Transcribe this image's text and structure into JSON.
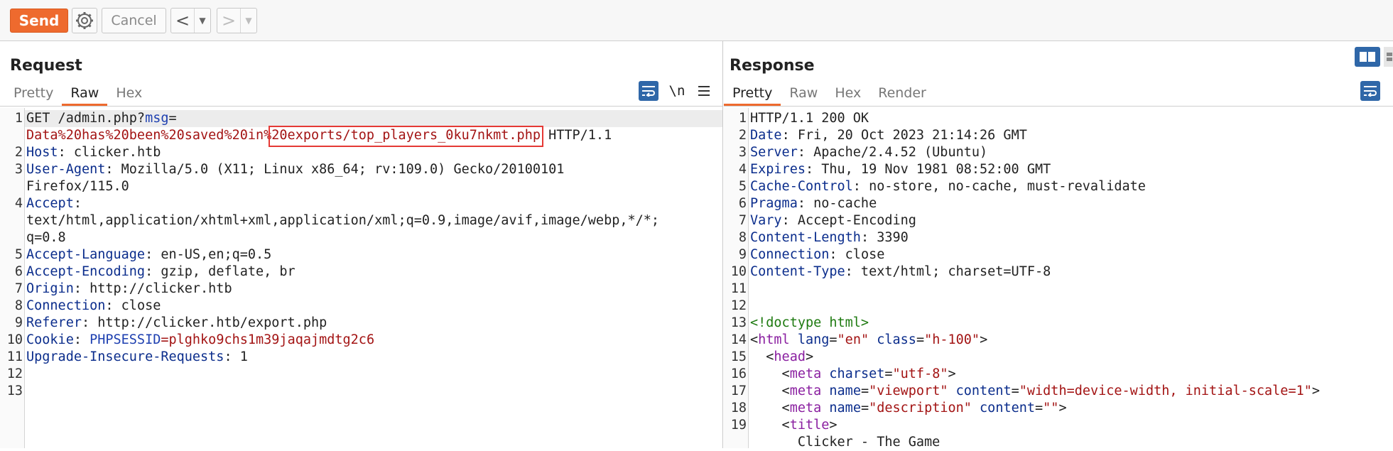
{
  "toolbar": {
    "send_label": "Send",
    "cancel_label": "Cancel"
  },
  "request": {
    "title": "Request",
    "tabs": [
      "Pretty",
      "Raw",
      "Hex"
    ],
    "active_tab": "Raw",
    "newline_toggle": "\\n",
    "lines": [
      {
        "n": "1",
        "key": "GET /admin.php?",
        "param": "msg",
        "rest": "="
      },
      {
        "n": "",
        "red": "Data%20has%20been%20saved%20in%20exports/top_players_0ku7nkmt.php",
        "tail": " HTTP/1.1"
      },
      {
        "n": "2",
        "key": "Host",
        "val": ": clicker.htb"
      },
      {
        "n": "3",
        "key": "User-Agent",
        "val": ": Mozilla/5.0 (X11; Linux x86_64; rv:109.0) Gecko/20100101"
      },
      {
        "n": "",
        "val": "Firefox/115.0"
      },
      {
        "n": "4",
        "key": "Accept",
        "val": ":"
      },
      {
        "n": "",
        "val": "text/html,application/xhtml+xml,application/xml;q=0.9,image/avif,image/webp,*/*;"
      },
      {
        "n": "",
        "val": "q=0.8"
      },
      {
        "n": "5",
        "key": "Accept-Language",
        "val": ": en-US,en;q=0.5"
      },
      {
        "n": "6",
        "key": "Accept-Encoding",
        "val": ": gzip, deflate, br"
      },
      {
        "n": "7",
        "key": "Origin",
        "val": ": http://clicker.htb"
      },
      {
        "n": "8",
        "key": "Connection",
        "val": ": close"
      },
      {
        "n": "9",
        "key": "Referer",
        "val": ": http://clicker.htb/export.php"
      },
      {
        "n": "10",
        "key": "Cookie",
        "val": ": ",
        "param": "PHPSESSID",
        "red": "=plghko9chs1m39jaqajmdtg2c6"
      },
      {
        "n": "11",
        "key": "Upgrade-Insecure-Requests",
        "val": ": 1"
      },
      {
        "n": "12"
      },
      {
        "n": "13"
      }
    ]
  },
  "response": {
    "title": "Response",
    "tabs": [
      "Pretty",
      "Raw",
      "Hex",
      "Render"
    ],
    "active_tab": "Pretty",
    "lines": [
      {
        "n": "1",
        "key": "HTTP/1.1 200 OK"
      },
      {
        "n": "2",
        "key": "Date",
        "val": ": Fri, 20 Oct 2023 21:14:26 GMT"
      },
      {
        "n": "3",
        "key": "Server",
        "val": ": Apache/2.4.52 (Ubuntu)"
      },
      {
        "n": "4",
        "key": "Expires",
        "val": ": Thu, 19 Nov 1981 08:52:00 GMT"
      },
      {
        "n": "5",
        "key": "Cache-Control",
        "val": ": no-store, no-cache, must-revalidate"
      },
      {
        "n": "6",
        "key": "Pragma",
        "val": ": no-cache"
      },
      {
        "n": "7",
        "key": "Vary",
        "val": ": Accept-Encoding"
      },
      {
        "n": "8",
        "key": "Content-Length",
        "val": ": 3390"
      },
      {
        "n": "9",
        "key": "Connection",
        "val": ": close"
      },
      {
        "n": "10",
        "key": "Content-Type",
        "val": ": text/html; charset=UTF-8"
      },
      {
        "n": "11"
      },
      {
        "n": "12"
      },
      {
        "n": "13",
        "doctype": "<!doctype html>"
      },
      {
        "n": "14",
        "html": [
          [
            "p",
            "<"
          ],
          [
            "t",
            "html"
          ],
          [
            "p",
            " "
          ],
          [
            "a",
            "lang"
          ],
          [
            "p",
            "="
          ],
          [
            "s",
            "\"en\""
          ],
          [
            "p",
            " "
          ],
          [
            "a",
            "class"
          ],
          [
            "p",
            "="
          ],
          [
            "s",
            "\"h-100\""
          ],
          [
            "p",
            ">"
          ]
        ]
      },
      {
        "n": "15",
        "html": [
          [
            "p",
            "  <"
          ],
          [
            "t",
            "head"
          ],
          [
            "p",
            ">"
          ]
        ]
      },
      {
        "n": "16",
        "html": [
          [
            "p",
            "    <"
          ],
          [
            "t",
            "meta"
          ],
          [
            "p",
            " "
          ],
          [
            "a",
            "charset"
          ],
          [
            "p",
            "="
          ],
          [
            "s",
            "\"utf-8\""
          ],
          [
            "p",
            ">"
          ]
        ]
      },
      {
        "n": "17",
        "html": [
          [
            "p",
            "    <"
          ],
          [
            "t",
            "meta"
          ],
          [
            "p",
            " "
          ],
          [
            "a",
            "name"
          ],
          [
            "p",
            "="
          ],
          [
            "s",
            "\"viewport\""
          ],
          [
            "p",
            " "
          ],
          [
            "a",
            "content"
          ],
          [
            "p",
            "="
          ],
          [
            "s",
            "\"width=device-width, initial-scale=1\""
          ],
          [
            "p",
            ">"
          ]
        ]
      },
      {
        "n": "18",
        "html": [
          [
            "p",
            "    <"
          ],
          [
            "t",
            "meta"
          ],
          [
            "p",
            " "
          ],
          [
            "a",
            "name"
          ],
          [
            "p",
            "="
          ],
          [
            "s",
            "\"description\""
          ],
          [
            "p",
            " "
          ],
          [
            "a",
            "content"
          ],
          [
            "p",
            "="
          ],
          [
            "s",
            "\"\""
          ],
          [
            "p",
            ">"
          ]
        ]
      },
      {
        "n": "19",
        "html": [
          [
            "p",
            "    <"
          ],
          [
            "t",
            "title"
          ],
          [
            "p",
            ">"
          ]
        ]
      },
      {
        "n": "",
        "html": [
          [
            "p",
            "      Clicker - The Game"
          ]
        ]
      }
    ]
  }
}
